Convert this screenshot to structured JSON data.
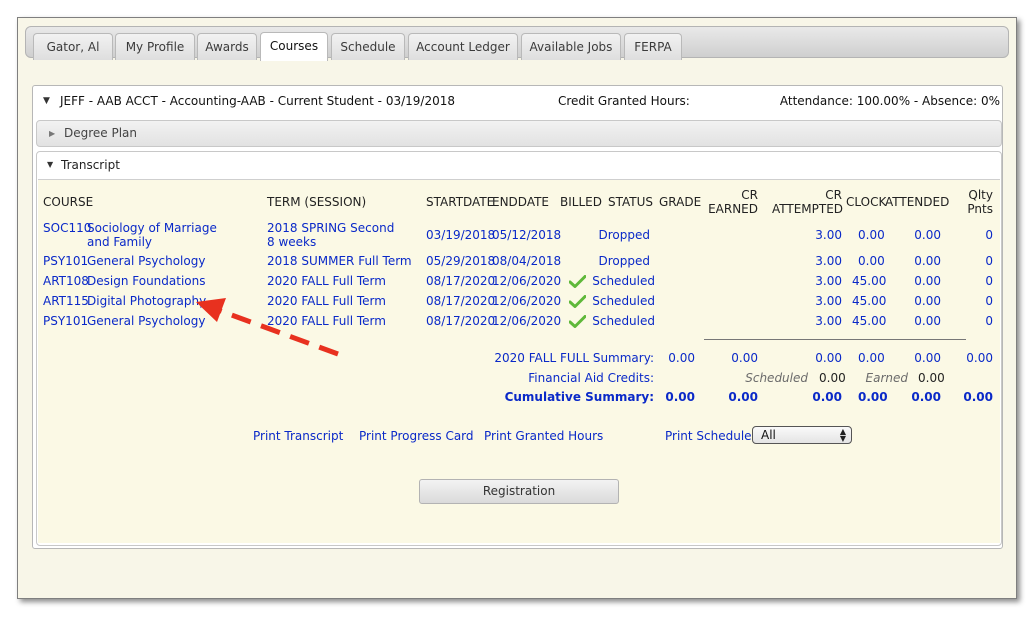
{
  "tabs": [
    {
      "label": "Gator, Al",
      "active": false
    },
    {
      "label": "My Profile",
      "active": false
    },
    {
      "label": "Awards",
      "active": false
    },
    {
      "label": "Courses",
      "active": true
    },
    {
      "label": "Schedule",
      "active": false
    },
    {
      "label": "Account Ledger",
      "active": false
    },
    {
      "label": "Available Jobs",
      "active": false
    },
    {
      "label": "FERPA",
      "active": false
    }
  ],
  "student": {
    "info": "JEFF - AAB ACCT - Accounting-AAB - Current Student - 03/19/2018",
    "credit_label": "Credit Granted Hours:",
    "attendance": "Attendance: 100.00% - Absence: 0%"
  },
  "sections": {
    "degree_plan": "Degree Plan",
    "transcript": "Transcript"
  },
  "columns": {
    "course": "COURSE",
    "term": "TERM (SESSION)",
    "startdate": "STARTDATE",
    "enddate": "ENDDATE",
    "billed": "BILLED",
    "status": "STATUS",
    "grade": "GRADE",
    "cr_earned_1": "CR",
    "cr_earned_2": "EARNED",
    "cr_attempted_1": "CR",
    "cr_attempted_2": "ATTEMPTED",
    "clock": "CLOCK",
    "attended": "ATTENDED",
    "qlty_1": "Qlty",
    "qlty_2": "Pnts"
  },
  "rows": [
    {
      "code": "SOC110",
      "name": "Sociology of Marriage and Family",
      "term": "2018 SPRING Second 8 weeks",
      "start": "03/19/2018",
      "end": "05/12/2018",
      "billed": false,
      "status": "Dropped",
      "attempted": "3.00",
      "clock": "0.00",
      "attended": "0.00",
      "qlty": "0"
    },
    {
      "code": "PSY101",
      "name": "General Psychology",
      "term": "2018 SUMMER Full Term",
      "start": "05/29/2018",
      "end": "08/04/2018",
      "billed": false,
      "status": "Dropped",
      "attempted": "3.00",
      "clock": "0.00",
      "attended": "0.00",
      "qlty": "0"
    },
    {
      "code": "ART108",
      "name": "Design Foundations",
      "term": "2020 FALL Full Term",
      "start": "08/17/2020",
      "end": "12/06/2020",
      "billed": true,
      "status": "Scheduled",
      "attempted": "3.00",
      "clock": "45.00",
      "attended": "0.00",
      "qlty": "0"
    },
    {
      "code": "ART115",
      "name": "Digital Photography",
      "term": "2020 FALL Full Term",
      "start": "08/17/2020",
      "end": "12/06/2020",
      "billed": true,
      "status": "Scheduled",
      "attempted": "3.00",
      "clock": "45.00",
      "attended": "0.00",
      "qlty": "0"
    },
    {
      "code": "PSY101",
      "name": "General Psychology",
      "term": "2020 FALL Full Term",
      "start": "08/17/2020",
      "end": "12/06/2020",
      "billed": true,
      "status": "Scheduled",
      "attempted": "3.00",
      "clock": "45.00",
      "attended": "0.00",
      "qlty": "0"
    }
  ],
  "summary": {
    "fall_label": "2020 FALL FULL Summary:",
    "fall_grade": "0.00",
    "fall_earned": "0.00",
    "fall_attempted": "0.00",
    "fall_clock": "0.00",
    "fall_attended": "0.00",
    "fall_qlty": "0.00",
    "aid_label": "Financial Aid Credits:",
    "aid_scheduled_label": "Scheduled",
    "aid_scheduled": "0.00",
    "aid_earned_label": "Earned",
    "aid_earned": "0.00",
    "cum_label": "Cumulative Summary:",
    "cum_grade": "0.00",
    "cum_earned": "0.00",
    "cum_attempted": "0.00",
    "cum_clock": "0.00",
    "cum_attended": "0.00",
    "cum_qlty": "0.00"
  },
  "links": {
    "print_transcript": "Print Transcript",
    "print_progress": "Print Progress Card",
    "print_granted": "Print Granted Hours",
    "print_schedule": "Print Schedule"
  },
  "schedule_select": {
    "value": "All"
  },
  "registration_button": "Registration",
  "colors": {
    "link_blue": "#0a29c8",
    "check_green": "#5fb83a",
    "annotation_red": "#e8311f",
    "panel_bg": "#fbf9e5"
  }
}
